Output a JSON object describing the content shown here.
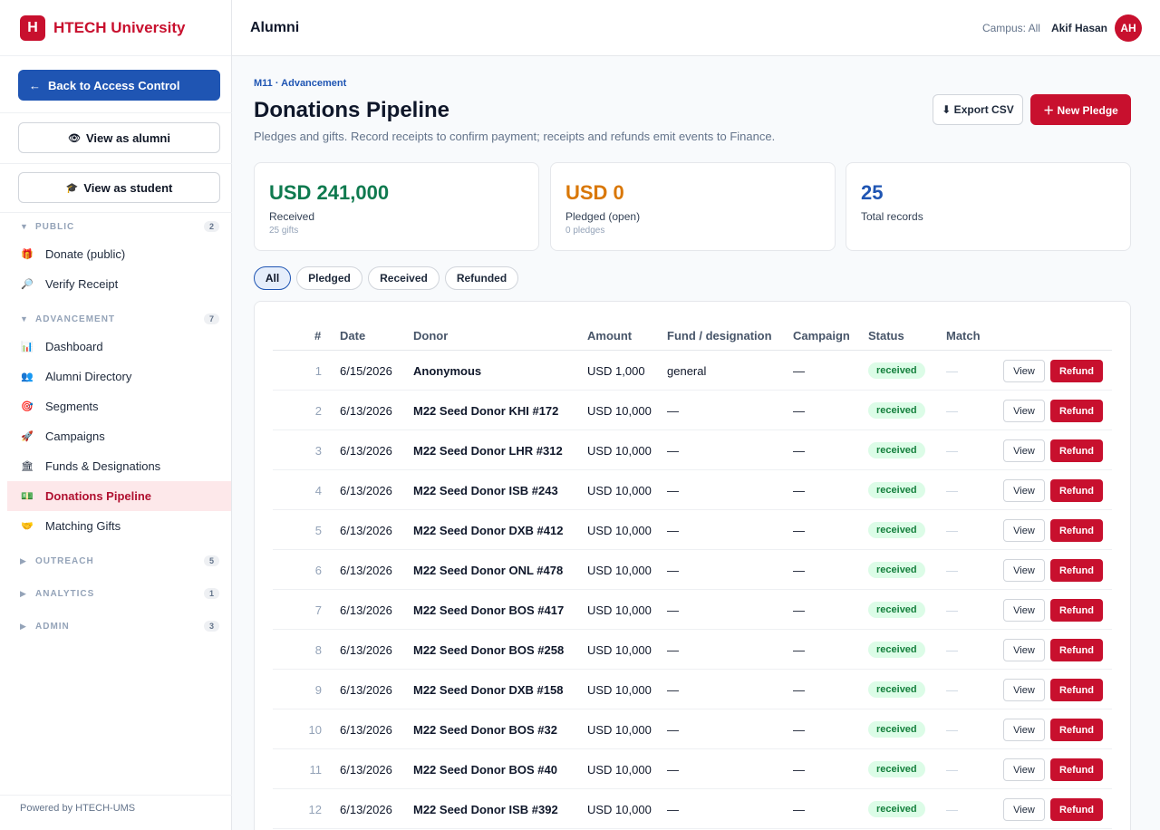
{
  "brand": {
    "logo_letter": "H",
    "name": "HTECH University",
    "color": "#c8102e"
  },
  "sidebar": {
    "back_label": "Back to Access Control",
    "view_alumni_label": "View as alumni",
    "view_student_label": "View as student",
    "sections": [
      {
        "label": "PUBLIC",
        "count": "2",
        "expanded": true,
        "items": [
          {
            "label": "Donate (public)",
            "icon": "gift-icon"
          },
          {
            "label": "Verify Receipt",
            "icon": "magnifier-icon"
          }
        ]
      },
      {
        "label": "ADVANCEMENT",
        "count": "7",
        "expanded": true,
        "items": [
          {
            "label": "Dashboard",
            "icon": "bar-chart-icon"
          },
          {
            "label": "Alumni Directory",
            "icon": "people-icon"
          },
          {
            "label": "Segments",
            "icon": "target-icon"
          },
          {
            "label": "Campaigns",
            "icon": "rocket-icon"
          },
          {
            "label": "Funds & Designations",
            "icon": "bank-icon"
          },
          {
            "label": "Donations Pipeline",
            "icon": "money-icon",
            "active": true
          },
          {
            "label": "Matching Gifts",
            "icon": "handshake-icon"
          }
        ]
      },
      {
        "label": "OUTREACH",
        "count": "5",
        "expanded": false,
        "items": []
      },
      {
        "label": "ANALYTICS",
        "count": "1",
        "expanded": false,
        "items": []
      },
      {
        "label": "ADMIN",
        "count": "3",
        "expanded": false,
        "items": []
      }
    ],
    "powered_by": "Powered by HTECH-UMS"
  },
  "topbar": {
    "title": "Alumni",
    "campus": "Campus: All",
    "user_name": "Akif Hasan",
    "user_initials": "AH"
  },
  "page": {
    "breadcrumb": "M11 · Advancement",
    "title": "Donations Pipeline",
    "subtitle": "Pledges and gifts. Record receipts to confirm payment; receipts and refunds emit events to Finance.",
    "export_label": "⬇ Export CSV",
    "new_label": "＋ New Pledge"
  },
  "stats": [
    {
      "value": "USD 241,000",
      "label": "Received",
      "sub": "25 gifts",
      "color": "#0f7a4f"
    },
    {
      "value": "USD 0",
      "label": "Pledged (open)",
      "sub": "0 pledges",
      "color": "#d97706"
    },
    {
      "value": "25",
      "label": "Total records",
      "sub": "",
      "color": "#1f55b3"
    }
  ],
  "filters": [
    {
      "label": "All",
      "active": true
    },
    {
      "label": "Pledged",
      "active": false
    },
    {
      "label": "Received",
      "active": false
    },
    {
      "label": "Refunded",
      "active": false
    }
  ],
  "table": {
    "columns": [
      "#",
      "Date",
      "Donor",
      "Amount",
      "Fund / designation",
      "Campaign",
      "Status",
      "Match"
    ],
    "view_label": "View",
    "refund_label": "Refund",
    "rows": [
      {
        "n": "1",
        "date": "6/15/2026",
        "donor": "Anonymous",
        "amount": "USD 1,000",
        "fund": "general",
        "campaign": "—",
        "status": "received",
        "match": "—"
      },
      {
        "n": "2",
        "date": "6/13/2026",
        "donor": "M22 Seed Donor KHI #172",
        "amount": "USD 10,000",
        "fund": "—",
        "campaign": "—",
        "status": "received",
        "match": "—"
      },
      {
        "n": "3",
        "date": "6/13/2026",
        "donor": "M22 Seed Donor LHR #312",
        "amount": "USD 10,000",
        "fund": "—",
        "campaign": "—",
        "status": "received",
        "match": "—"
      },
      {
        "n": "4",
        "date": "6/13/2026",
        "donor": "M22 Seed Donor ISB #243",
        "amount": "USD 10,000",
        "fund": "—",
        "campaign": "—",
        "status": "received",
        "match": "—"
      },
      {
        "n": "5",
        "date": "6/13/2026",
        "donor": "M22 Seed Donor DXB #412",
        "amount": "USD 10,000",
        "fund": "—",
        "campaign": "—",
        "status": "received",
        "match": "—"
      },
      {
        "n": "6",
        "date": "6/13/2026",
        "donor": "M22 Seed Donor ONL #478",
        "amount": "USD 10,000",
        "fund": "—",
        "campaign": "—",
        "status": "received",
        "match": "—"
      },
      {
        "n": "7",
        "date": "6/13/2026",
        "donor": "M22 Seed Donor BOS #417",
        "amount": "USD 10,000",
        "fund": "—",
        "campaign": "—",
        "status": "received",
        "match": "—"
      },
      {
        "n": "8",
        "date": "6/13/2026",
        "donor": "M22 Seed Donor BOS #258",
        "amount": "USD 10,000",
        "fund": "—",
        "campaign": "—",
        "status": "received",
        "match": "—"
      },
      {
        "n": "9",
        "date": "6/13/2026",
        "donor": "M22 Seed Donor DXB #158",
        "amount": "USD 10,000",
        "fund": "—",
        "campaign": "—",
        "status": "received",
        "match": "—"
      },
      {
        "n": "10",
        "date": "6/13/2026",
        "donor": "M22 Seed Donor BOS #32",
        "amount": "USD 10,000",
        "fund": "—",
        "campaign": "—",
        "status": "received",
        "match": "—"
      },
      {
        "n": "11",
        "date": "6/13/2026",
        "donor": "M22 Seed Donor BOS #40",
        "amount": "USD 10,000",
        "fund": "—",
        "campaign": "—",
        "status": "received",
        "match": "—"
      },
      {
        "n": "12",
        "date": "6/13/2026",
        "donor": "M22 Seed Donor ISB #392",
        "amount": "USD 10,000",
        "fund": "—",
        "campaign": "—",
        "status": "received",
        "match": "—"
      }
    ]
  }
}
